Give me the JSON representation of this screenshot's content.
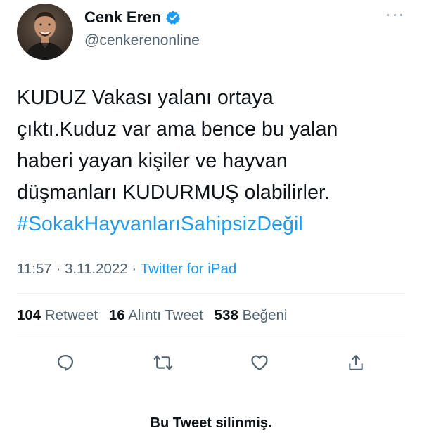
{
  "user": {
    "display_name": "Cenk Eren",
    "handle": "@cenkerenonline",
    "verified": true
  },
  "tweet": {
    "lines": [
      "KUDUZ Vakası yalanı ortaya",
      "çıktı.Kuduz var ama bence bu yalan",
      "haberi yayan kişiler ve hayvan",
      "düşmanları KUDURMUŞ olabilirler."
    ],
    "hashtag": "#SokakHayvanlarıSahipsizDeğil"
  },
  "meta": {
    "time": "11:57",
    "separator": "·",
    "date": "3.11.2022",
    "source": "Twitter for iPad"
  },
  "stats": {
    "retweets_count": "104",
    "retweets_label": "Retweet",
    "quotes_count": "16",
    "quotes_label": "Alıntı Tweet",
    "likes_count": "538",
    "likes_label": "Beğeni"
  },
  "actions": {
    "reply_icon": "reply-icon",
    "retweet_icon": "retweet-icon",
    "like_icon": "like-icon",
    "share_icon": "share-icon"
  },
  "colors": {
    "text": "#0f1419",
    "secondary": "#536471",
    "accent": "#1d9bf0",
    "divider": "#eff3f4"
  },
  "caption": "Bu Tweet silinmiş."
}
